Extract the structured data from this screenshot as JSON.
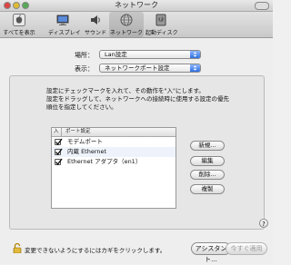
{
  "window": {
    "title": "ネットワーク"
  },
  "toolbar": {
    "items": [
      {
        "label": "すべてを表示",
        "icon": "apple-grid-icon"
      },
      {
        "label": "ディスプレイ",
        "icon": "display-icon"
      },
      {
        "label": "サウンド",
        "icon": "speaker-icon"
      },
      {
        "label": "ネットワーク",
        "icon": "globe-icon"
      },
      {
        "label": "起動ディスク",
        "icon": "disk-icon"
      }
    ]
  },
  "location": {
    "label": "場所：",
    "value": "Lan設定"
  },
  "show": {
    "label": "表示：",
    "value": "ネットワークポート設定"
  },
  "description": {
    "line1": "設定にチェックマークを入れて、その動作を\"入\"にします。",
    "line2": "設定をドラッグして、ネットワークへの接続時に使用する設定の優先",
    "line3": "順位を指定してください。"
  },
  "table": {
    "col_on": "入",
    "col_name": "ポート設定",
    "rows": [
      {
        "checked": true,
        "name": "モデムポート"
      },
      {
        "checked": true,
        "name": "内蔵 Ethernet"
      },
      {
        "checked": true,
        "name": "Ethernet アダプタ（en1）"
      }
    ]
  },
  "buttons": {
    "new": "新規...",
    "edit": "編集",
    "delete": "削除...",
    "duplicate": "複製"
  },
  "help": "?",
  "footer": {
    "lock_text": "変更できないようにするにはカギをクリックします。",
    "assistant": "アシスタント...",
    "apply": "今すぐ適用"
  },
  "colors": {
    "accent": "#2d6fe0"
  }
}
